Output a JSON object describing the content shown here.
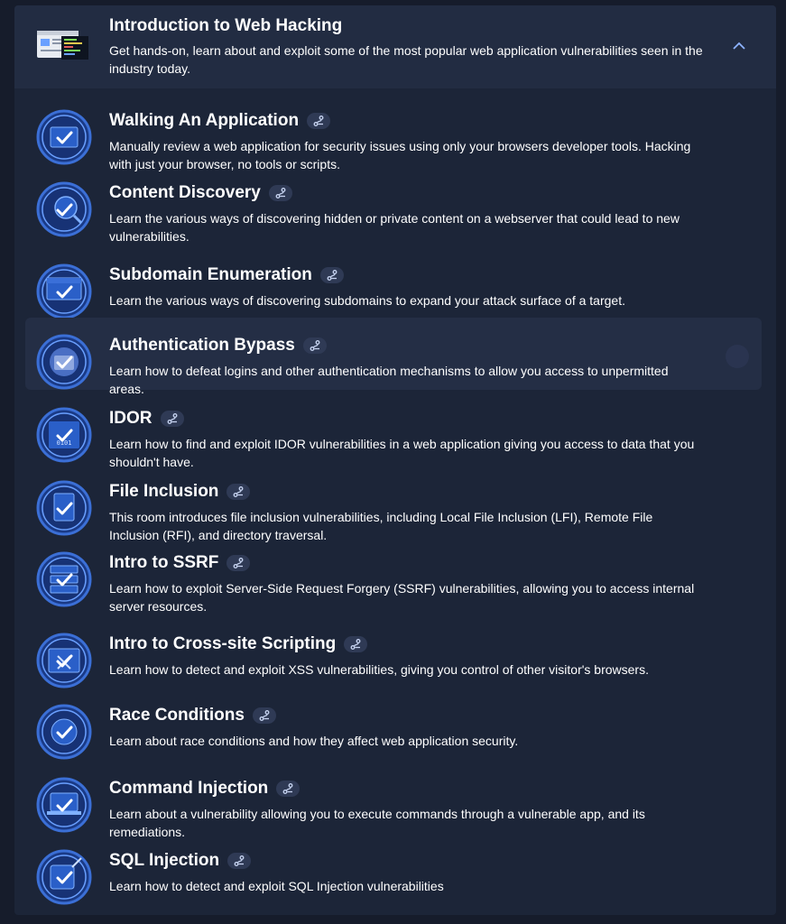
{
  "module": {
    "title": "Introduction to Web Hacking",
    "description": "Get hands-on, learn about and exploit some of the most popular web application vulnerabilities seen in the industry today.",
    "toggle_icon": "chevron-up-icon"
  },
  "rooms": [
    {
      "title": "Walking An Application",
      "description": "Manually review a web application for security issues using only your browsers developer tools. Hacking with just your browser, no tools or scripts.",
      "icon": "browser-tools-icon",
      "completed": true
    },
    {
      "title": "Content Discovery",
      "description": "Learn the various ways of discovering hidden or private content on a webserver that could lead to new vulnerabilities.",
      "icon": "magnifier-icon",
      "completed": true
    },
    {
      "title": "Subdomain Enumeration",
      "description": "Learn the various ways of discovering subdomains to expand your attack surface of a target.",
      "icon": "www-window-icon",
      "completed": true
    },
    {
      "title": "Authentication Bypass",
      "description": "Learn how to defeat logins and other authentication mechanisms to allow you access to unpermitted areas.",
      "icon": "login-bypass-icon",
      "completed": true
    },
    {
      "title": "IDOR",
      "description": "Learn how to find and exploit IDOR vulnerabilities in a web application giving you access to data that you shouldn't have.",
      "icon": "binary-data-icon",
      "completed": true
    },
    {
      "title": "File Inclusion",
      "description": "This room introduces file inclusion vulnerabilities, including Local File Inclusion (LFI), Remote File Inclusion (RFI), and directory traversal.",
      "icon": "file-icon",
      "completed": true
    },
    {
      "title": "Intro to SSRF",
      "description": "Learn how to exploit Server-Side Request Forgery (SSRF) vulnerabilities, allowing you to access internal server resources.",
      "icon": "server-icon",
      "completed": true
    },
    {
      "title": "Intro to Cross-site Scripting",
      "description": "Learn how to detect and exploit XSS vulnerabilities, giving you control of other visitor's browsers.",
      "icon": "browser-x-icon",
      "completed": true
    },
    {
      "title": "Race Conditions",
      "description": "Learn about race conditions and how they affect web application security.",
      "icon": "race-icon",
      "completed": true
    },
    {
      "title": "Command Injection",
      "description": "Learn about a vulnerability allowing you to execute commands through a vulnerable app, and its remediations.",
      "icon": "laptop-terminal-icon",
      "completed": true
    },
    {
      "title": "SQL Injection",
      "description": "Learn how to detect and exploit SQL Injection vulnerabilities",
      "icon": "database-syringe-icon",
      "completed": true
    }
  ],
  "highlighted_room_index": 3,
  "colors": {
    "page_bg": "#161c2b",
    "panel_bg": "#1c2538",
    "header_bg": "#222c42",
    "icon_ring": "#3b6fd6",
    "accent": "#6aa0ff"
  }
}
